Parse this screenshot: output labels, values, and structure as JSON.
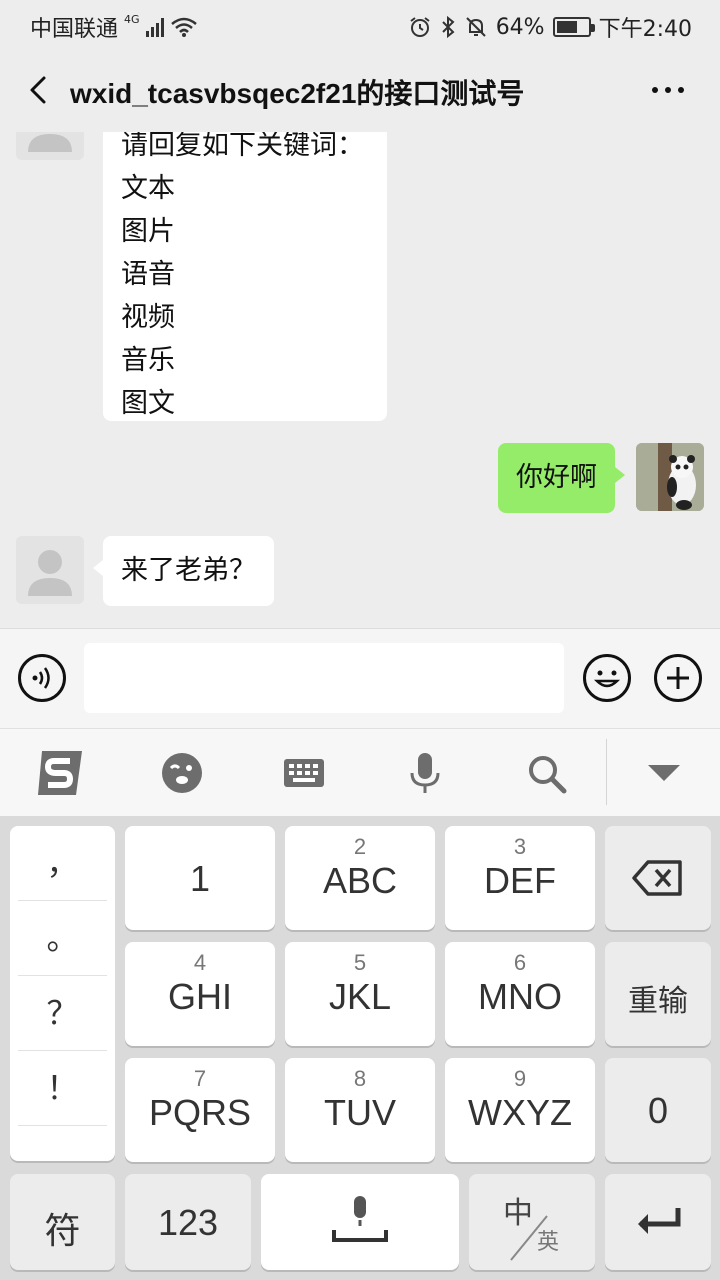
{
  "status_bar": {
    "carrier": "中国联通",
    "network": "4G",
    "battery": "64%",
    "time": "下午2:40",
    "icons": [
      "signal-icon",
      "wifi-icon",
      "alarm-icon",
      "bluetooth-icon",
      "mute-icon",
      "battery-icon"
    ]
  },
  "header": {
    "title": "wxid_tcasvbsqec2f21的接口测试号",
    "back_icon": "back-arrow-icon",
    "more_icon": "more-icon"
  },
  "chat": {
    "messages": [
      {
        "side": "left",
        "partial_top": "请回复如下关键词：",
        "lines": [
          "文本",
          "图片",
          "语音",
          "视频",
          "音乐",
          "图文"
        ]
      },
      {
        "side": "right",
        "text": "你好啊"
      },
      {
        "side": "left",
        "text": "来了老弟？"
      }
    ]
  },
  "input_bar": {
    "voice_icon": "voice-icon",
    "emoji_icon": "emoji-icon",
    "plus_icon": "plus-icon"
  },
  "keyboard_toolbar": {
    "icons": [
      "sogou-logo-icon",
      "wink-emoji-icon",
      "keyboard-icon",
      "microphone-icon",
      "search-icon",
      "collapse-icon"
    ]
  },
  "keyboard": {
    "punctuation": [
      "，",
      "。",
      "？",
      "！"
    ],
    "row1": [
      {
        "sub": "",
        "main": "1"
      },
      {
        "sub": "2",
        "main": "ABC"
      },
      {
        "sub": "3",
        "main": "DEF"
      }
    ],
    "row2": [
      {
        "sub": "4",
        "main": "GHI"
      },
      {
        "sub": "5",
        "main": "JKL"
      },
      {
        "sub": "6",
        "main": "MNO"
      }
    ],
    "row3": [
      {
        "sub": "7",
        "main": "PQRS"
      },
      {
        "sub": "8",
        "main": "TUV"
      },
      {
        "sub": "9",
        "main": "WXYZ"
      }
    ],
    "reenter": "重输",
    "zero": "0",
    "symbols": "符",
    "numbers": "123",
    "lang_top": "中",
    "lang_bottom": "英"
  }
}
